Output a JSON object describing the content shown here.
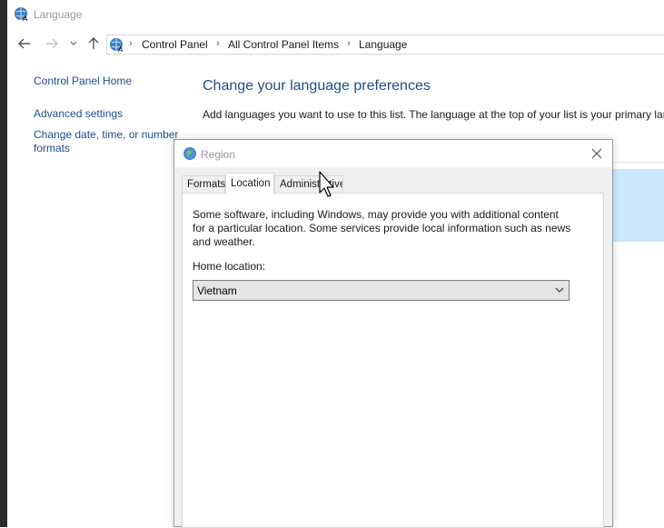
{
  "window": {
    "title": "Language"
  },
  "navbar": {
    "back_icon": "arrow-left-icon",
    "forward_icon": "arrow-right-icon",
    "recent_icon": "chevron-down-icon",
    "up_icon": "arrow-up-icon",
    "breadcrumbs": [
      "Control Panel",
      "All Control Panel Items",
      "Language"
    ]
  },
  "sidebar": {
    "items": [
      {
        "label": "Control Panel Home"
      },
      {
        "label": "Advanced settings"
      },
      {
        "label": "Change date, time, or number"
      },
      {
        "label": "formats"
      }
    ]
  },
  "main": {
    "title": "Change your language preferences",
    "description": "Add languages you want to use to this list. The language at the top of your list is your primary lar"
  },
  "dialog": {
    "title": "Region",
    "close_label": "✕",
    "tabs": [
      {
        "label": "Formats",
        "active": false
      },
      {
        "label": "Location",
        "active": true
      },
      {
        "label": "Administrative",
        "active": false
      }
    ],
    "info_text": "Some software, including Windows, may provide you with additional content for a particular location. Some services provide local information such as news and weather.",
    "home_location_label": "Home location:",
    "home_location_value": "Vietnam"
  },
  "colors": {
    "link": "#1e4e8c",
    "selection": "#cce8ff",
    "dialog_bg": "#f0f0f0"
  }
}
